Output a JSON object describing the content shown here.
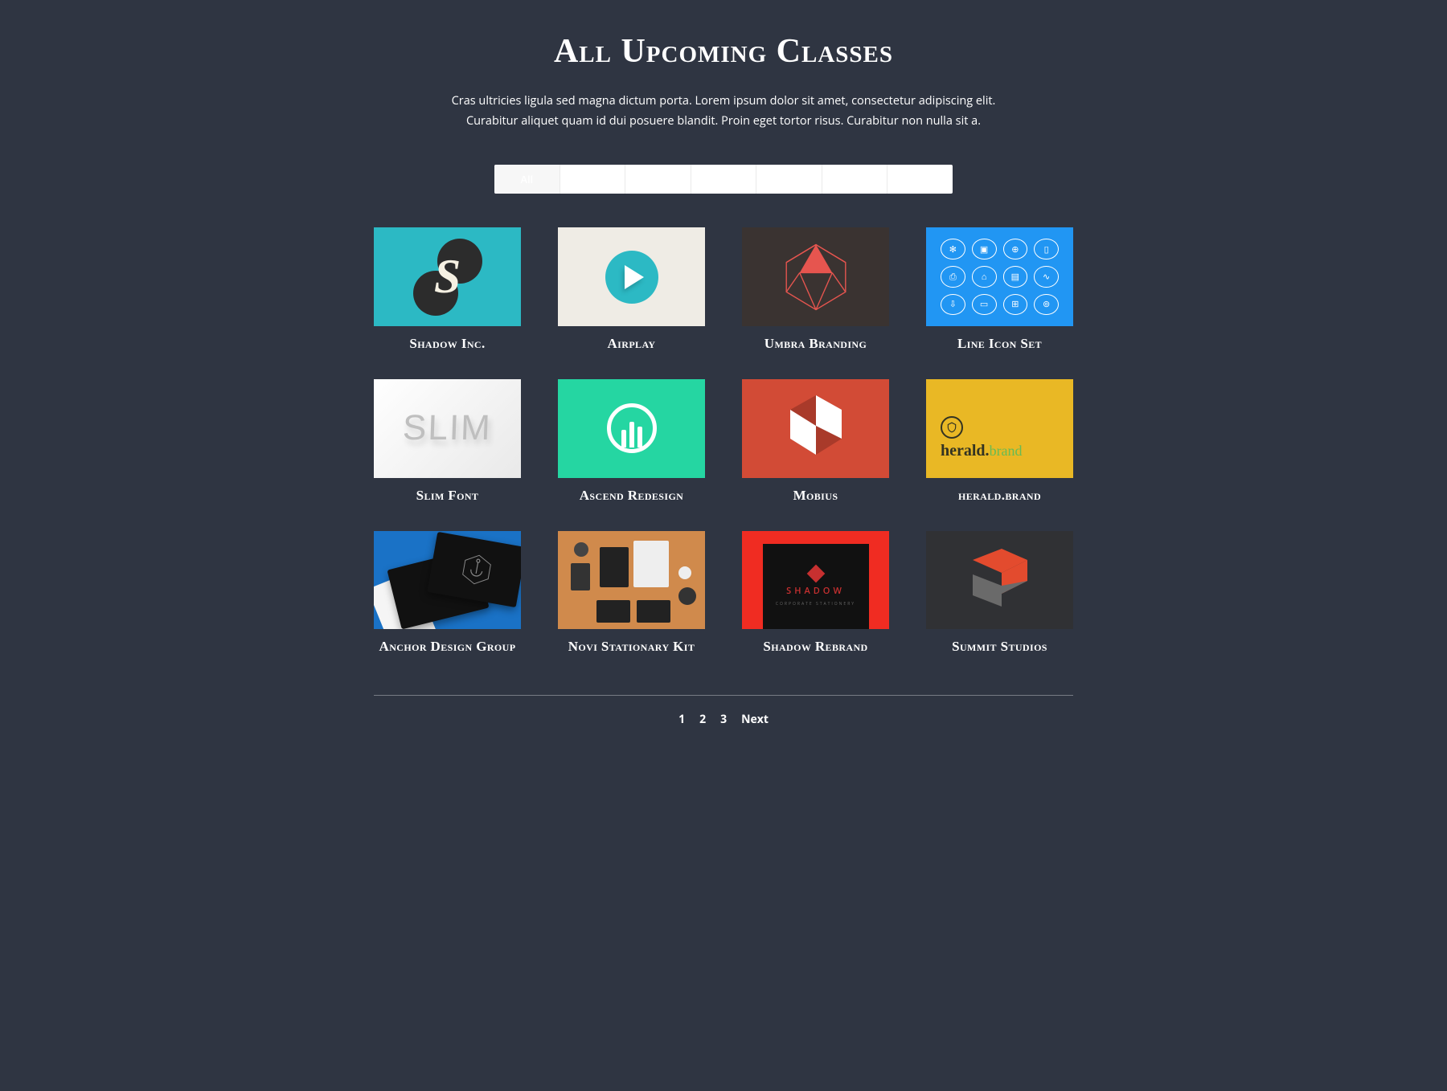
{
  "header": {
    "title": "All Upcoming Classes",
    "subtitle": "Cras ultricies ligula sed magna dictum porta. Lorem ipsum dolor sit amet, consectetur adipiscing elit. Curabitur aliquet quam id dui posuere blandit. Proin eget tortor risus. Curabitur non nulla sit a."
  },
  "filters": [
    {
      "label": "All",
      "active": true
    },
    {
      "label": " ",
      "active": false
    },
    {
      "label": " ",
      "active": false
    },
    {
      "label": " ",
      "active": false
    },
    {
      "label": " ",
      "active": false
    },
    {
      "label": " ",
      "active": false
    },
    {
      "label": " ",
      "active": false
    }
  ],
  "cards": [
    {
      "title": "Shadow Inc.",
      "thumb": "shadow"
    },
    {
      "title": "Airplay",
      "thumb": "airplay"
    },
    {
      "title": "Umbra Branding",
      "thumb": "umbra"
    },
    {
      "title": "Line Icon Set",
      "thumb": "lineicon"
    },
    {
      "title": "Slim Font",
      "thumb": "slim"
    },
    {
      "title": "Ascend Redesign",
      "thumb": "ascend"
    },
    {
      "title": "Mobius",
      "thumb": "mobius"
    },
    {
      "title": "herald.brand",
      "thumb": "herald"
    },
    {
      "title": "Anchor Design Group",
      "thumb": "anchor"
    },
    {
      "title": "Novi Stationary Kit",
      "thumb": "novi"
    },
    {
      "title": "Shadow Rebrand",
      "thumb": "shrebrand"
    },
    {
      "title": "Summit Studios",
      "thumb": "summit"
    }
  ],
  "herald": {
    "brand_bold": "herald.",
    "brand_light": "brand"
  },
  "slim": {
    "text": "SLIM"
  },
  "shrebrand": {
    "label": "SHADOW",
    "sub": "CORPORATE STATIONERY"
  },
  "pagination": {
    "pages": [
      "1",
      "2",
      "3"
    ],
    "next": "Next"
  }
}
